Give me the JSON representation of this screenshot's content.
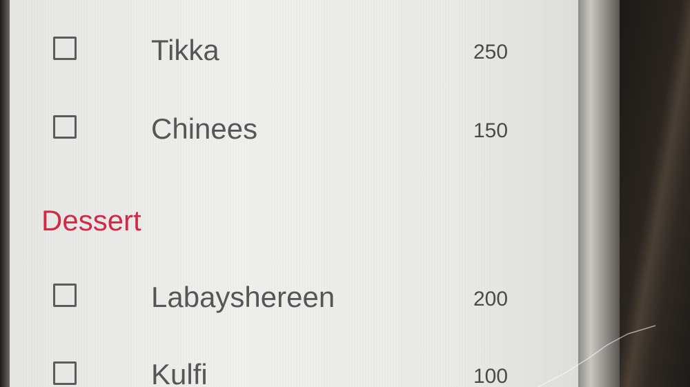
{
  "menu": {
    "items_top": [
      {
        "name": "Tikka",
        "price": "250"
      },
      {
        "name": "Chinees",
        "price": "150"
      }
    ],
    "section": {
      "title": "Dessert",
      "items": [
        {
          "name": "Labayshereen",
          "price": "200"
        },
        {
          "name": "Kulfi",
          "price": "100"
        }
      ]
    }
  },
  "colors": {
    "accent": "#d02a46",
    "text": "#565656",
    "screen_bg": "#ececea"
  },
  "icons": {
    "checkbox": "checkbox-icon"
  }
}
